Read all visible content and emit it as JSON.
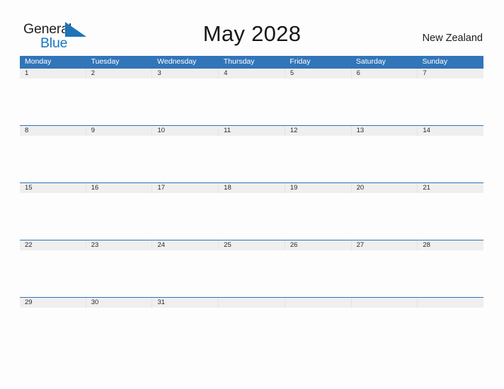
{
  "brand": {
    "name_part1": "General",
    "name_part2": "Blue",
    "triangle_color": "#1d74b8",
    "text_color": "#231f20",
    "accent_color": "#1577c4"
  },
  "header": {
    "title": "May 2028",
    "country": "New Zealand"
  },
  "theme": {
    "header_blue": "#3275b8",
    "row_border_blue": "#2e74b5",
    "date_band_gray": "#efefef",
    "page_background": "#fdfdfd"
  },
  "calendar": {
    "month": "May",
    "year": "2028",
    "weekday_headers": [
      "Monday",
      "Tuesday",
      "Wednesday",
      "Thursday",
      "Friday",
      "Saturday",
      "Sunday"
    ],
    "weeks": [
      {
        "days": [
          "1",
          "2",
          "3",
          "4",
          "5",
          "6",
          "7"
        ]
      },
      {
        "days": [
          "8",
          "9",
          "10",
          "11",
          "12",
          "13",
          "14"
        ]
      },
      {
        "days": [
          "15",
          "16",
          "17",
          "18",
          "19",
          "20",
          "21"
        ]
      },
      {
        "days": [
          "22",
          "23",
          "24",
          "25",
          "26",
          "27",
          "28"
        ]
      },
      {
        "days": [
          "29",
          "30",
          "31",
          "",
          "",
          "",
          ""
        ]
      }
    ]
  }
}
